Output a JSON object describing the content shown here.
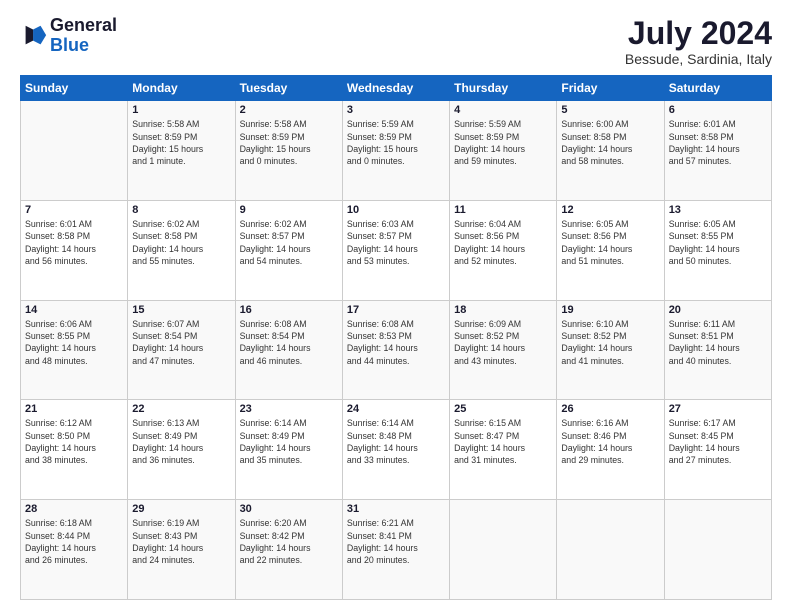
{
  "logo": {
    "text_general": "General",
    "text_blue": "Blue"
  },
  "title": {
    "month_year": "July 2024",
    "location": "Bessude, Sardinia, Italy"
  },
  "weekdays": [
    "Sunday",
    "Monday",
    "Tuesday",
    "Wednesday",
    "Thursday",
    "Friday",
    "Saturday"
  ],
  "weeks": [
    [
      {
        "day": "",
        "info": ""
      },
      {
        "day": "1",
        "info": "Sunrise: 5:58 AM\nSunset: 8:59 PM\nDaylight: 15 hours\nand 1 minute."
      },
      {
        "day": "2",
        "info": "Sunrise: 5:58 AM\nSunset: 8:59 PM\nDaylight: 15 hours\nand 0 minutes."
      },
      {
        "day": "3",
        "info": "Sunrise: 5:59 AM\nSunset: 8:59 PM\nDaylight: 15 hours\nand 0 minutes."
      },
      {
        "day": "4",
        "info": "Sunrise: 5:59 AM\nSunset: 8:59 PM\nDaylight: 14 hours\nand 59 minutes."
      },
      {
        "day": "5",
        "info": "Sunrise: 6:00 AM\nSunset: 8:58 PM\nDaylight: 14 hours\nand 58 minutes."
      },
      {
        "day": "6",
        "info": "Sunrise: 6:01 AM\nSunset: 8:58 PM\nDaylight: 14 hours\nand 57 minutes."
      }
    ],
    [
      {
        "day": "7",
        "info": "Sunrise: 6:01 AM\nSunset: 8:58 PM\nDaylight: 14 hours\nand 56 minutes."
      },
      {
        "day": "8",
        "info": "Sunrise: 6:02 AM\nSunset: 8:58 PM\nDaylight: 14 hours\nand 55 minutes."
      },
      {
        "day": "9",
        "info": "Sunrise: 6:02 AM\nSunset: 8:57 PM\nDaylight: 14 hours\nand 54 minutes."
      },
      {
        "day": "10",
        "info": "Sunrise: 6:03 AM\nSunset: 8:57 PM\nDaylight: 14 hours\nand 53 minutes."
      },
      {
        "day": "11",
        "info": "Sunrise: 6:04 AM\nSunset: 8:56 PM\nDaylight: 14 hours\nand 52 minutes."
      },
      {
        "day": "12",
        "info": "Sunrise: 6:05 AM\nSunset: 8:56 PM\nDaylight: 14 hours\nand 51 minutes."
      },
      {
        "day": "13",
        "info": "Sunrise: 6:05 AM\nSunset: 8:55 PM\nDaylight: 14 hours\nand 50 minutes."
      }
    ],
    [
      {
        "day": "14",
        "info": "Sunrise: 6:06 AM\nSunset: 8:55 PM\nDaylight: 14 hours\nand 48 minutes."
      },
      {
        "day": "15",
        "info": "Sunrise: 6:07 AM\nSunset: 8:54 PM\nDaylight: 14 hours\nand 47 minutes."
      },
      {
        "day": "16",
        "info": "Sunrise: 6:08 AM\nSunset: 8:54 PM\nDaylight: 14 hours\nand 46 minutes."
      },
      {
        "day": "17",
        "info": "Sunrise: 6:08 AM\nSunset: 8:53 PM\nDaylight: 14 hours\nand 44 minutes."
      },
      {
        "day": "18",
        "info": "Sunrise: 6:09 AM\nSunset: 8:52 PM\nDaylight: 14 hours\nand 43 minutes."
      },
      {
        "day": "19",
        "info": "Sunrise: 6:10 AM\nSunset: 8:52 PM\nDaylight: 14 hours\nand 41 minutes."
      },
      {
        "day": "20",
        "info": "Sunrise: 6:11 AM\nSunset: 8:51 PM\nDaylight: 14 hours\nand 40 minutes."
      }
    ],
    [
      {
        "day": "21",
        "info": "Sunrise: 6:12 AM\nSunset: 8:50 PM\nDaylight: 14 hours\nand 38 minutes."
      },
      {
        "day": "22",
        "info": "Sunrise: 6:13 AM\nSunset: 8:49 PM\nDaylight: 14 hours\nand 36 minutes."
      },
      {
        "day": "23",
        "info": "Sunrise: 6:14 AM\nSunset: 8:49 PM\nDaylight: 14 hours\nand 35 minutes."
      },
      {
        "day": "24",
        "info": "Sunrise: 6:14 AM\nSunset: 8:48 PM\nDaylight: 14 hours\nand 33 minutes."
      },
      {
        "day": "25",
        "info": "Sunrise: 6:15 AM\nSunset: 8:47 PM\nDaylight: 14 hours\nand 31 minutes."
      },
      {
        "day": "26",
        "info": "Sunrise: 6:16 AM\nSunset: 8:46 PM\nDaylight: 14 hours\nand 29 minutes."
      },
      {
        "day": "27",
        "info": "Sunrise: 6:17 AM\nSunset: 8:45 PM\nDaylight: 14 hours\nand 27 minutes."
      }
    ],
    [
      {
        "day": "28",
        "info": "Sunrise: 6:18 AM\nSunset: 8:44 PM\nDaylight: 14 hours\nand 26 minutes."
      },
      {
        "day": "29",
        "info": "Sunrise: 6:19 AM\nSunset: 8:43 PM\nDaylight: 14 hours\nand 24 minutes."
      },
      {
        "day": "30",
        "info": "Sunrise: 6:20 AM\nSunset: 8:42 PM\nDaylight: 14 hours\nand 22 minutes."
      },
      {
        "day": "31",
        "info": "Sunrise: 6:21 AM\nSunset: 8:41 PM\nDaylight: 14 hours\nand 20 minutes."
      },
      {
        "day": "",
        "info": ""
      },
      {
        "day": "",
        "info": ""
      },
      {
        "day": "",
        "info": ""
      }
    ]
  ]
}
